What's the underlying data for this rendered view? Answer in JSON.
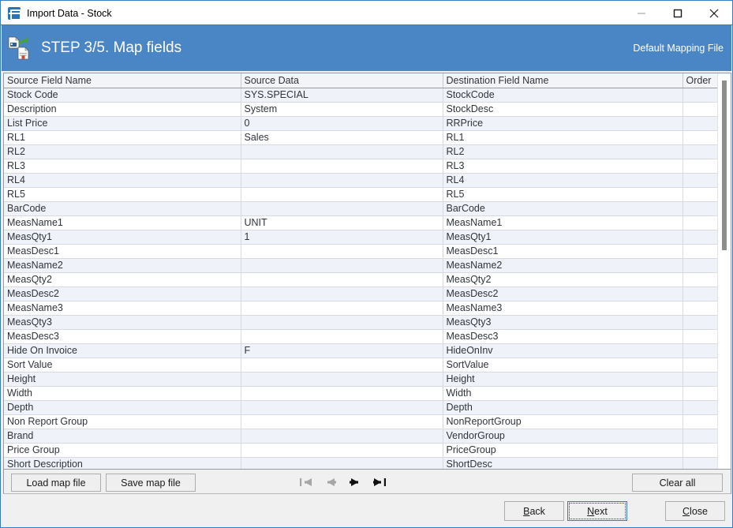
{
  "window": {
    "title": "Import Data - Stock",
    "icon": "app-icon",
    "controls": {
      "minimize": "minimize-icon",
      "maximize": "maximize-icon",
      "close": "close-icon"
    }
  },
  "banner": {
    "icon": "import-documents-icon",
    "title": "STEP 3/5. Map fields",
    "right_label": "Default Mapping File",
    "color": "#4a86c5"
  },
  "grid": {
    "columns": [
      "Source Field Name",
      "Source Data",
      "Destination Field Name",
      "Order"
    ],
    "rows": [
      {
        "source_field": "Stock Code",
        "source_data": "SYS.SPECIAL",
        "destination_field": "StockCode",
        "order": ""
      },
      {
        "source_field": "Description",
        "source_data": "System",
        "destination_field": "StockDesc",
        "order": ""
      },
      {
        "source_field": "List Price",
        "source_data": "0",
        "destination_field": "RRPrice",
        "order": ""
      },
      {
        "source_field": "RL1",
        "source_data": "Sales",
        "destination_field": "RL1",
        "order": ""
      },
      {
        "source_field": "RL2",
        "source_data": "",
        "destination_field": "RL2",
        "order": ""
      },
      {
        "source_field": "RL3",
        "source_data": "",
        "destination_field": "RL3",
        "order": ""
      },
      {
        "source_field": "RL4",
        "source_data": "",
        "destination_field": "RL4",
        "order": ""
      },
      {
        "source_field": "RL5",
        "source_data": "",
        "destination_field": "RL5",
        "order": ""
      },
      {
        "source_field": "BarCode",
        "source_data": "",
        "destination_field": "BarCode",
        "order": ""
      },
      {
        "source_field": "MeasName1",
        "source_data": "UNIT",
        "destination_field": "MeasName1",
        "order": ""
      },
      {
        "source_field": "MeasQty1",
        "source_data": "1",
        "destination_field": "MeasQty1",
        "order": ""
      },
      {
        "source_field": "MeasDesc1",
        "source_data": "",
        "destination_field": "MeasDesc1",
        "order": ""
      },
      {
        "source_field": "MeasName2",
        "source_data": "",
        "destination_field": "MeasName2",
        "order": ""
      },
      {
        "source_field": "MeasQty2",
        "source_data": "",
        "destination_field": "MeasQty2",
        "order": ""
      },
      {
        "source_field": "MeasDesc2",
        "source_data": "",
        "destination_field": "MeasDesc2",
        "order": ""
      },
      {
        "source_field": "MeasName3",
        "source_data": "",
        "destination_field": "MeasName3",
        "order": ""
      },
      {
        "source_field": "MeasQty3",
        "source_data": "",
        "destination_field": "MeasQty3",
        "order": ""
      },
      {
        "source_field": "MeasDesc3",
        "source_data": "",
        "destination_field": "MeasDesc3",
        "order": ""
      },
      {
        "source_field": "Hide On Invoice",
        "source_data": "F",
        "destination_field": "HideOnInv",
        "order": ""
      },
      {
        "source_field": "Sort Value",
        "source_data": "",
        "destination_field": "SortValue",
        "order": ""
      },
      {
        "source_field": "Height",
        "source_data": "",
        "destination_field": "Height",
        "order": ""
      },
      {
        "source_field": "Width",
        "source_data": "",
        "destination_field": "Width",
        "order": ""
      },
      {
        "source_field": "Depth",
        "source_data": "",
        "destination_field": "Depth",
        "order": ""
      },
      {
        "source_field": "Non Report Group",
        "source_data": "",
        "destination_field": "NonReportGroup",
        "order": ""
      },
      {
        "source_field": "Brand",
        "source_data": "",
        "destination_field": "VendorGroup",
        "order": ""
      },
      {
        "source_field": "Price Group",
        "source_data": "",
        "destination_field": "PriceGroup",
        "order": ""
      },
      {
        "source_field": "Short Description",
        "source_data": "",
        "destination_field": "ShortDesc",
        "order": ""
      }
    ]
  },
  "toolbar": {
    "load_map_file": "Load map file",
    "save_map_file": "Save map file",
    "clear_all": "Clear all",
    "nav": {
      "first": "first-record-icon",
      "previous": "previous-record-icon",
      "next": "next-record-icon",
      "last": "last-record-icon",
      "first_enabled": false,
      "previous_enabled": false,
      "next_enabled": true,
      "last_enabled": true
    }
  },
  "footer": {
    "back": "Back",
    "back_mnemonic": "B",
    "next": "Next",
    "next_mnemonic": "N",
    "close": "Close",
    "close_mnemonic": "C",
    "default_button": "Next"
  }
}
